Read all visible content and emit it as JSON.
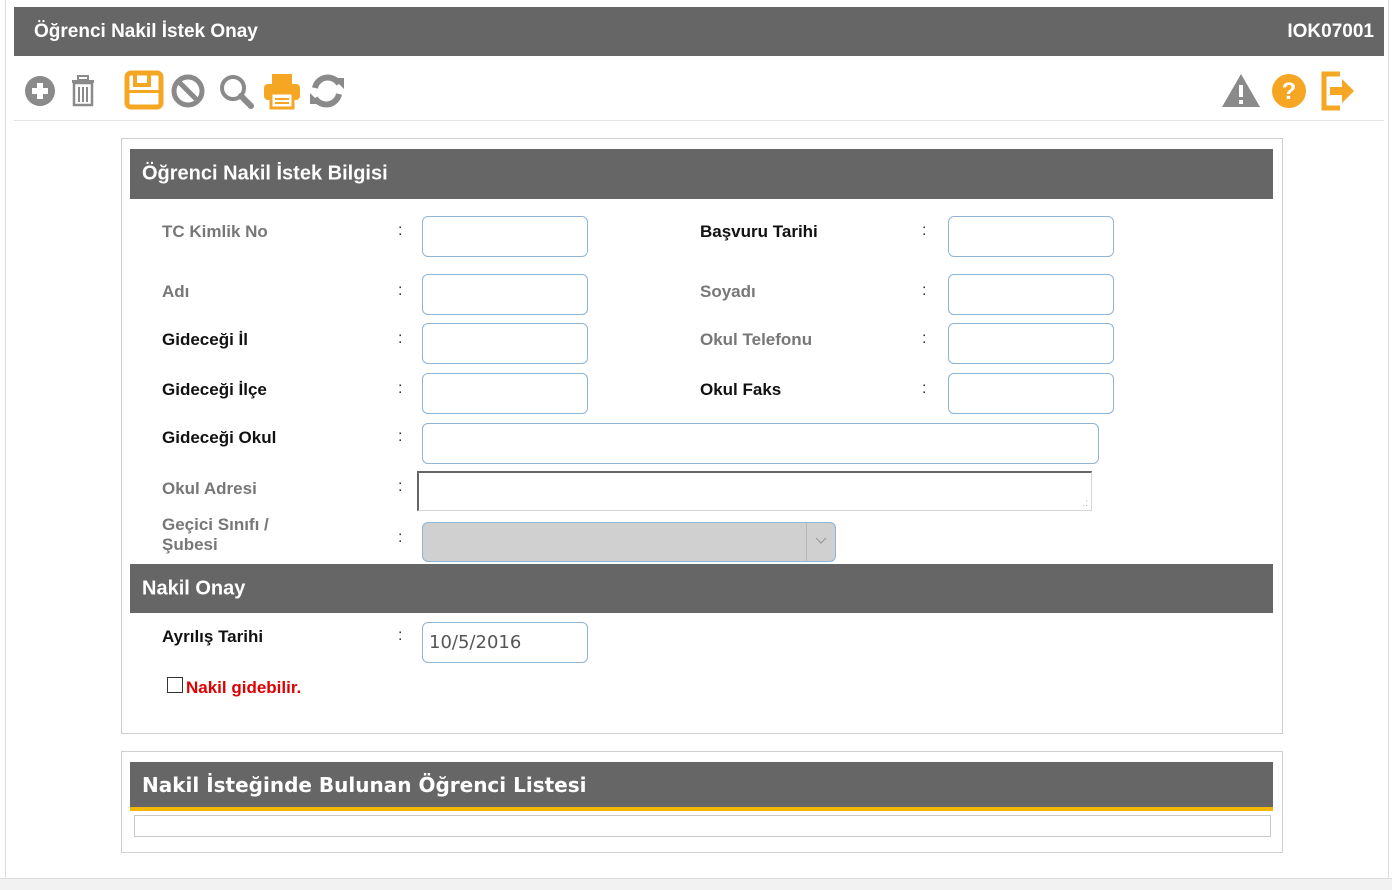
{
  "header": {
    "title": "Öğrenci Nakil İstek Onay",
    "code": "IOK07001"
  },
  "toolbar": {
    "left": [
      "add-icon",
      "delete-icon",
      "save-icon",
      "cancel-icon",
      "search-icon",
      "print-icon",
      "refresh-icon"
    ],
    "right": [
      "warning-icon",
      "help-icon",
      "exit-icon"
    ]
  },
  "colors": {
    "header_bg": "#666666",
    "accent_orange": "#f5a623",
    "icon_gray": "#8a8a8a",
    "required_red": "#e00000",
    "tab_underline": "#f2b705"
  },
  "request_section": {
    "title": "Öğrenci Nakil İstek Bilgisi",
    "fields": {
      "tc_no": {
        "label": "TC Kimlik No",
        "value": ""
      },
      "application_date": {
        "label": "Başvuru Tarihi",
        "value": ""
      },
      "name": {
        "label": "Adı",
        "value": ""
      },
      "surname": {
        "label": "Soyadı",
        "value": ""
      },
      "target_city": {
        "label": "Gideceği İl",
        "value": ""
      },
      "school_phone": {
        "label": "Okul Telefonu",
        "value": ""
      },
      "target_district": {
        "label": "Gideceği İlçe",
        "value": ""
      },
      "school_fax": {
        "label": "Okul Faks",
        "value": ""
      },
      "target_school": {
        "label": "Gideceği Okul",
        "value": ""
      },
      "school_address": {
        "label": "Okul Adresi",
        "value": ""
      },
      "temp_class": {
        "label_line1": "Geçici Sınıfı /",
        "label_line2": "Şubesi",
        "value": ""
      }
    }
  },
  "approval_section": {
    "title": "Nakil Onay",
    "departure_date": {
      "label": "Ayrılış Tarihi",
      "value": "10/5/2016"
    },
    "transfer_checkbox": {
      "label": "Nakil gidebilir.",
      "checked": false
    }
  },
  "list_section": {
    "title": "Nakil İsteğinde Bulunan Öğrenci Listesi"
  },
  "colon": ":"
}
